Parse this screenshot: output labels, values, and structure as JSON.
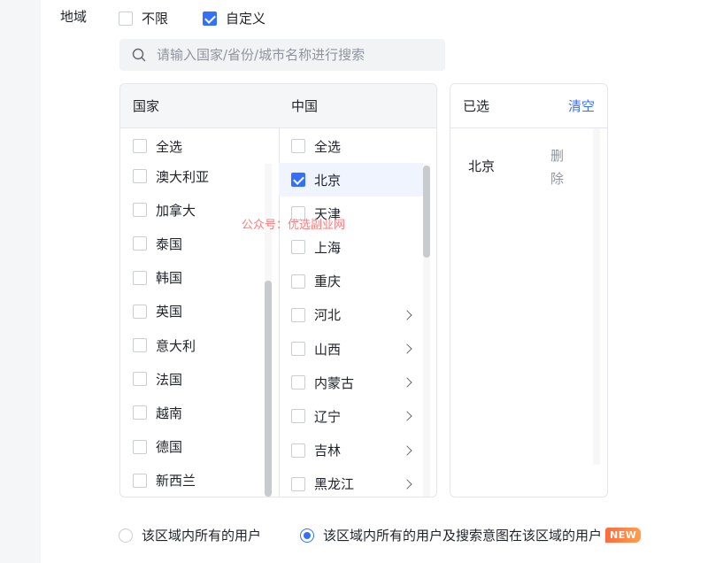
{
  "region_label": "地域",
  "scope": {
    "unlimited_label": "不限",
    "unlimited_checked": false,
    "custom_label": "自定义",
    "custom_checked": true
  },
  "search": {
    "placeholder": "请输入国家/省份/城市名称进行搜索",
    "value": ""
  },
  "country_column": {
    "header": "国家",
    "select_all": "全选",
    "items": [
      "澳大利亚",
      "加拿大",
      "泰国",
      "韩国",
      "英国",
      "意大利",
      "法国",
      "越南",
      "德国",
      "新西兰"
    ]
  },
  "region_column": {
    "header": "中国",
    "select_all": "全选",
    "items": [
      {
        "label": "北京",
        "checked": true,
        "has_children": false
      },
      {
        "label": "天津",
        "checked": false,
        "has_children": false
      },
      {
        "label": "上海",
        "checked": false,
        "has_children": false
      },
      {
        "label": "重庆",
        "checked": false,
        "has_children": false
      },
      {
        "label": "河北",
        "checked": false,
        "has_children": true
      },
      {
        "label": "山西",
        "checked": false,
        "has_children": true
      },
      {
        "label": "内蒙古",
        "checked": false,
        "has_children": true
      },
      {
        "label": "辽宁",
        "checked": false,
        "has_children": true
      },
      {
        "label": "吉林",
        "checked": false,
        "has_children": true
      },
      {
        "label": "黑龙江",
        "checked": false,
        "has_children": true
      }
    ]
  },
  "selected_panel": {
    "header": "已选",
    "clear_label": "清空",
    "items": [
      {
        "label": "北京",
        "delete_label": "删除"
      }
    ]
  },
  "watermark": "公众号：优选副业网",
  "user_scope": {
    "option_1": "该区域内所有的用户",
    "option_1_selected": false,
    "option_2": "该区域内所有的用户及搜索意图在该区域的用户",
    "option_2_selected": true,
    "badge": "NEW"
  },
  "colors": {
    "accent": "#3370ff",
    "badge": "#ff6a3d"
  }
}
